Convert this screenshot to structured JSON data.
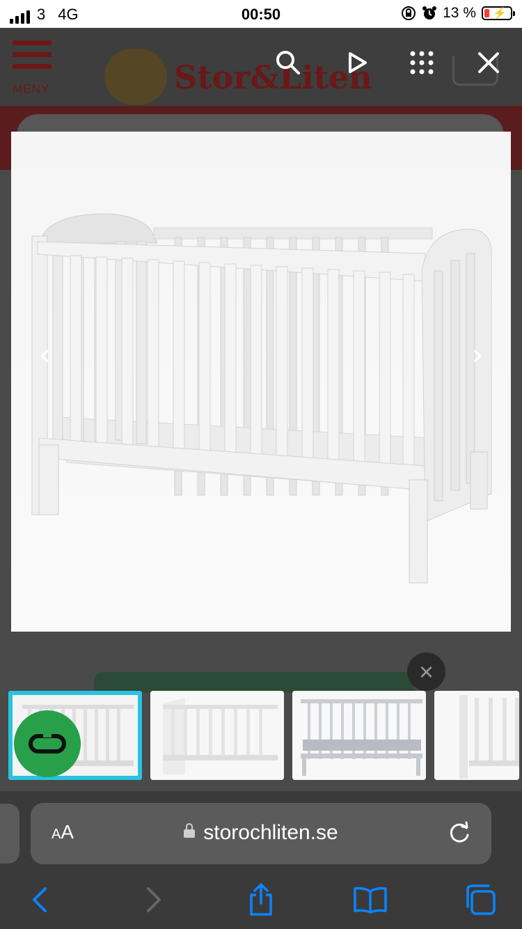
{
  "status_bar": {
    "carrier": "3",
    "network": "4G",
    "time": "00:50",
    "battery_percent": "13 %",
    "battery_level": 0.13
  },
  "site": {
    "menu_label": "MENY",
    "logo_text": "Stor&Liten"
  },
  "gallery": {
    "selected_index": 0,
    "thumbnail_count": 4
  },
  "safari": {
    "text_size_label_big": "A",
    "text_size_label_small": "A",
    "url": "storochliten.se"
  },
  "colors": {
    "accent_selection": "#29c3e0",
    "badge_green": "#28a04a",
    "safari_blue": "#0a84ff"
  },
  "icons": {
    "search": "search-icon",
    "play": "play-icon",
    "grid": "grid-icon",
    "close": "close-icon",
    "prev": "chevron-left-icon",
    "next": "chevron-right-icon"
  }
}
